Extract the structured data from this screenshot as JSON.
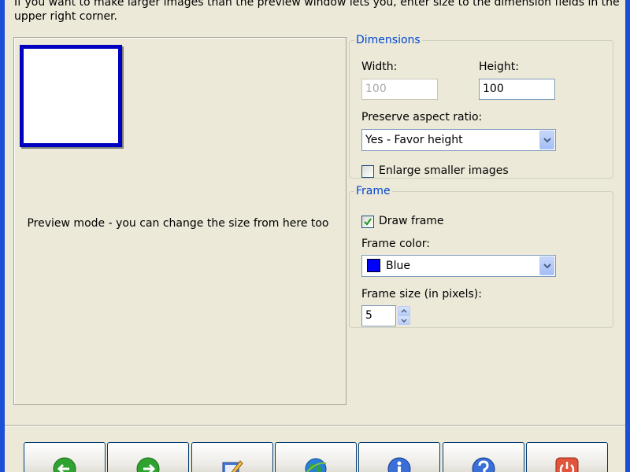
{
  "intro_text": "If you want to make larger images than the preview window lets you, enter size to the dimension fields in the upper right corner.",
  "preview": {
    "caption": "Preview mode - you can change the size from here too"
  },
  "dimensions": {
    "legend": "Dimensions",
    "width_label": "Width:",
    "width_value": "100",
    "height_label": "Height:",
    "height_value": "100",
    "aspect_label": "Preserve aspect ratio:",
    "aspect_value": "Yes - Favor height",
    "enlarge_label": "Enlarge smaller images",
    "enlarge_checked": false
  },
  "frame": {
    "legend": "Frame",
    "draw_label": "Draw frame",
    "draw_checked": true,
    "color_label": "Frame color:",
    "color_value": "Blue",
    "color_hex": "#0000ff",
    "size_label": "Frame size (in pixels):",
    "size_value": "5"
  },
  "toolbar": {
    "buttons": [
      {
        "icon": "back-arrow-icon"
      },
      {
        "icon": "forward-arrow-icon"
      },
      {
        "icon": "edit-icon"
      },
      {
        "icon": "globe-icon"
      },
      {
        "icon": "info-icon"
      },
      {
        "icon": "help-icon"
      },
      {
        "icon": "power-icon"
      }
    ]
  },
  "colors": {
    "title_bar": "#1d4fd6",
    "dialog_bg": "#ece9d8",
    "group_legend": "#0046d5",
    "preview_frame": "#0000c0"
  }
}
